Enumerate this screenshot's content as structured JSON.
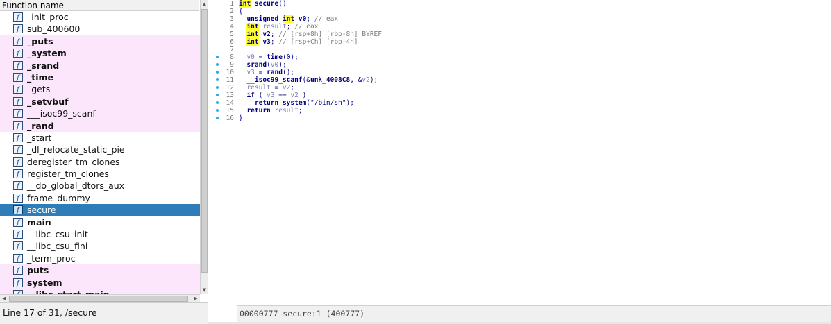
{
  "function_list": {
    "header": "Function name",
    "items": [
      {
        "name": "_init_proc",
        "lib": false,
        "bold": false,
        "selected": false
      },
      {
        "name": "sub_400600",
        "lib": false,
        "bold": false,
        "selected": false
      },
      {
        "name": "_puts",
        "lib": true,
        "bold": true,
        "selected": false
      },
      {
        "name": "_system",
        "lib": true,
        "bold": true,
        "selected": false
      },
      {
        "name": "_srand",
        "lib": true,
        "bold": true,
        "selected": false
      },
      {
        "name": "_time",
        "lib": true,
        "bold": true,
        "selected": false
      },
      {
        "name": "_gets",
        "lib": true,
        "bold": false,
        "selected": false
      },
      {
        "name": "_setvbuf",
        "lib": true,
        "bold": true,
        "selected": false
      },
      {
        "name": "___isoc99_scanf",
        "lib": true,
        "bold": false,
        "selected": false
      },
      {
        "name": "_rand",
        "lib": true,
        "bold": true,
        "selected": false
      },
      {
        "name": "_start",
        "lib": false,
        "bold": false,
        "selected": false
      },
      {
        "name": "_dl_relocate_static_pie",
        "lib": false,
        "bold": false,
        "selected": false
      },
      {
        "name": "deregister_tm_clones",
        "lib": false,
        "bold": false,
        "selected": false
      },
      {
        "name": "register_tm_clones",
        "lib": false,
        "bold": false,
        "selected": false
      },
      {
        "name": "__do_global_dtors_aux",
        "lib": false,
        "bold": false,
        "selected": false
      },
      {
        "name": "frame_dummy",
        "lib": false,
        "bold": false,
        "selected": false
      },
      {
        "name": "secure",
        "lib": false,
        "bold": false,
        "selected": true
      },
      {
        "name": "main",
        "lib": false,
        "bold": true,
        "selected": false
      },
      {
        "name": "__libc_csu_init",
        "lib": false,
        "bold": false,
        "selected": false
      },
      {
        "name": "__libc_csu_fini",
        "lib": false,
        "bold": false,
        "selected": false
      },
      {
        "name": "_term_proc",
        "lib": false,
        "bold": false,
        "selected": false
      },
      {
        "name": "puts",
        "lib": true,
        "bold": true,
        "selected": false
      },
      {
        "name": "system",
        "lib": true,
        "bold": true,
        "selected": false
      },
      {
        "name": "__libc_start_main",
        "lib": true,
        "bold": true,
        "selected": false
      }
    ],
    "icon_glyph": "f",
    "status": "Line 17 of 31, /secure"
  },
  "pseudocode": {
    "lines": [
      {
        "n": "1",
        "dot": false,
        "html": "<span class=\"kw\">int</span> <span class=\"b\">secure</span>()"
      },
      {
        "n": "2",
        "dot": false,
        "html": "{"
      },
      {
        "n": "3",
        "dot": false,
        "html": "  <span class=\"b\">unsigned</span> <span class=\"kw\">int</span> <span class=\"b\">v0</span>; <span class=\"cm\">// eax</span>"
      },
      {
        "n": "4",
        "dot": false,
        "html": "  <span class=\"kw\">int</span> <span class=\"gv\">result</span>; <span class=\"cm\">// eax</span>"
      },
      {
        "n": "5",
        "dot": false,
        "html": "  <span class=\"kw\">int</span> <span class=\"b\">v2</span>; <span class=\"cm\">// [rsp+8h] [rbp-8h] BYREF</span>"
      },
      {
        "n": "6",
        "dot": false,
        "html": "  <span class=\"kw\">int</span> <span class=\"b\">v3</span>; <span class=\"cm\">// [rsp+Ch] [rbp-4h]</span>"
      },
      {
        "n": "7",
        "dot": false,
        "html": ""
      },
      {
        "n": "8",
        "dot": true,
        "html": "  <span class=\"gv\">v0</span> = <span class=\"b\">time</span>(0);"
      },
      {
        "n": "9",
        "dot": true,
        "html": "  <span class=\"b\">srand</span>(<span class=\"gv\">v0</span>);"
      },
      {
        "n": "10",
        "dot": true,
        "html": "  <span class=\"gv\">v3</span> = <span class=\"b\">rand</span>();"
      },
      {
        "n": "11",
        "dot": true,
        "html": "  <span class=\"b\">__isoc99_scanf</span>(&amp;<span class=\"b\">unk_4008C8</span>, &amp;<span class=\"gv\">v2</span>);"
      },
      {
        "n": "12",
        "dot": true,
        "html": "  <span class=\"gv\">result</span> = <span class=\"gv\">v2</span>;"
      },
      {
        "n": "13",
        "dot": true,
        "html": "  <span class=\"b\">if</span> ( <span class=\"gv\">v3</span> == <span class=\"gv\">v2</span> )"
      },
      {
        "n": "14",
        "dot": true,
        "html": "    <span class=\"b\">return</span> <span class=\"b\">system</span>(<span class=\"st\">\"/bin/sh\"</span>);"
      },
      {
        "n": "15",
        "dot": true,
        "html": "  <span class=\"b\">return</span> <span class=\"gv\">result</span>;"
      },
      {
        "n": "16",
        "dot": true,
        "html": "}"
      }
    ],
    "status": "00000777 secure:1 (400777)"
  },
  "colors": {
    "selection": "#2f7db8",
    "library_row": "#fbe6fb",
    "keyword_highlight": "#ffff33",
    "breakpoint_dot": "#2aa8e8"
  }
}
